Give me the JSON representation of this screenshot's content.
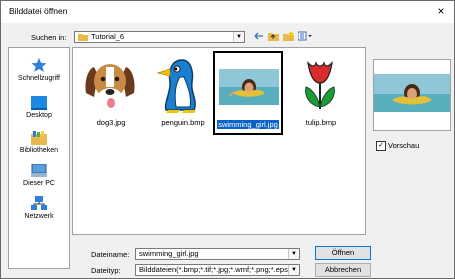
{
  "window": {
    "title": "Bilddatei öffnen",
    "close_glyph": "×"
  },
  "lookin": {
    "label": "Suchen in:",
    "value": "Tutorial_6"
  },
  "toolbar": {
    "icons": [
      "back-arrow-icon",
      "folder-up-icon",
      "new-folder-icon",
      "view-menu-icon"
    ]
  },
  "places": [
    {
      "label": "Schnellzugriff",
      "icon": "star-icon"
    },
    {
      "label": "Desktop",
      "icon": "desktop-icon"
    },
    {
      "label": "Bibliotheken",
      "icon": "library-icon"
    },
    {
      "label": "Dieser PC",
      "icon": "computer-icon"
    },
    {
      "label": "Netzwerk",
      "icon": "network-icon"
    }
  ],
  "files": [
    {
      "name": "dog3.jpg",
      "selected": false
    },
    {
      "name": "penguin.bmp",
      "selected": false
    },
    {
      "name": "swimming_girl.jpg",
      "selected": true
    },
    {
      "name": "tulip.bmp",
      "selected": false
    }
  ],
  "preview": {
    "checkbox_label": "Vorschau",
    "checked": true
  },
  "filename": {
    "label": "Dateiname:",
    "value": "swimming_girl.jpg"
  },
  "filetype": {
    "label": "Dateityp:",
    "value": "Bilddateien(*.bmp;*.tif;*.jpg;*.wmf;*.png;*.eps;*.g"
  },
  "buttons": {
    "open": "Öffnen",
    "cancel": "Abbrechen"
  },
  "colors": {
    "accent": "#0078d7",
    "selection": "#0a64c8",
    "folder": "#e8b84a"
  }
}
